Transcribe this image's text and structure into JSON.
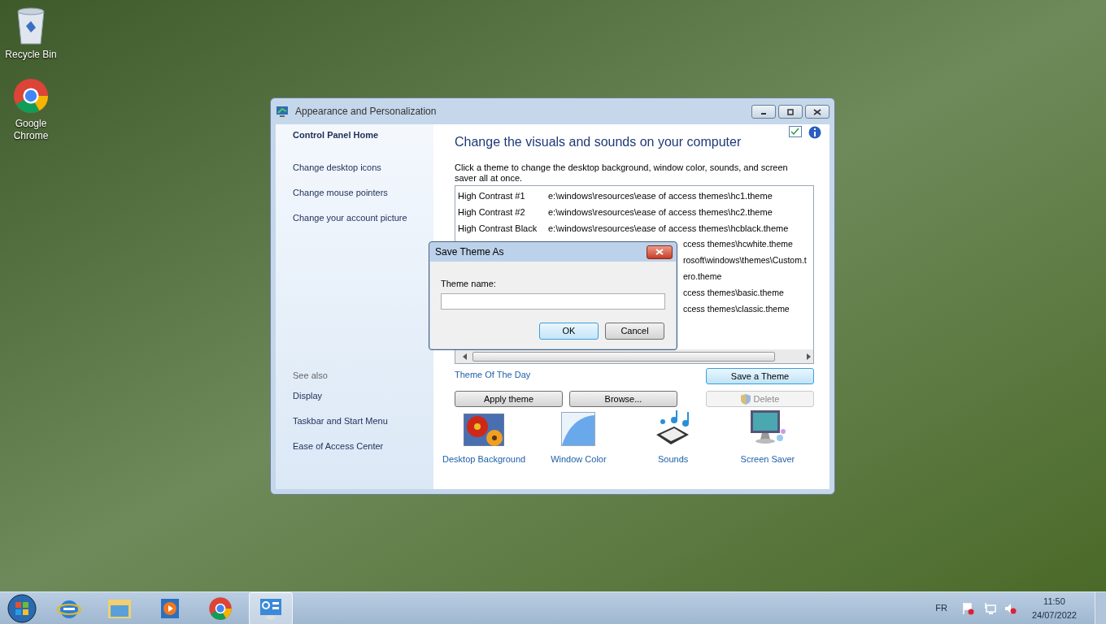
{
  "desktop_icons": [
    {
      "kind": "bin",
      "label": "Recycle Bin"
    },
    {
      "kind": "chrome",
      "label": "Google Chrome"
    }
  ],
  "window": {
    "title": "Appearance and Personalization",
    "sidebar": {
      "home": "Control Panel Home",
      "links": [
        "Change desktop icons",
        "Change mouse pointers",
        "Change your account picture"
      ],
      "see_also_title": "See also",
      "see_also": [
        "Display",
        "Taskbar and Start Menu",
        "Ease of Access Center"
      ]
    },
    "heading": "Change the visuals and sounds on your computer",
    "description": "Click a theme to change the desktop background, window color, sounds, and screen saver all at once.",
    "themes": [
      {
        "name": "High Contrast #1",
        "path": "e:\\windows\\resources\\ease of access themes\\hc1.theme"
      },
      {
        "name": "High Contrast #2",
        "path": "e:\\windows\\resources\\ease of access themes\\hc2.theme"
      },
      {
        "name": "High Contrast Black",
        "path": "e:\\windows\\resources\\ease of access themes\\hcblack.theme"
      },
      {
        "path": "ccess themes\\hcwhite.theme"
      },
      {
        "path": "rosoft\\windows\\themes\\Custom.t"
      },
      {
        "path": "ero.theme"
      },
      {
        "path": "ccess themes\\basic.theme"
      },
      {
        "path": "ccess themes\\classic.theme"
      }
    ],
    "theme_of_day": "Theme Of The Day",
    "buttons": [
      {
        "label": "Save a Theme",
        "kind": "default",
        "disabled": false
      },
      {
        "label": "Apply theme",
        "kind": "normal",
        "disabled": false
      },
      {
        "label": "Browse...",
        "kind": "normal",
        "disabled": false
      },
      {
        "label": "Delete",
        "kind": "shield",
        "disabled": true
      }
    ],
    "tiles": [
      {
        "kind": "background",
        "label": "Desktop Background"
      },
      {
        "kind": "color",
        "label": "Window Color"
      },
      {
        "kind": "sounds",
        "label": "Sounds"
      },
      {
        "kind": "saver",
        "label": "Screen Saver"
      }
    ]
  },
  "dialog": {
    "title": "Save Theme As",
    "field_label": "Theme name:",
    "buttons": [
      "OK",
      "Cancel"
    ]
  },
  "taskbar": {
    "apps": [
      {
        "kind": "ie",
        "active": false
      },
      {
        "kind": "explorer",
        "active": false
      },
      {
        "kind": "media",
        "active": false
      },
      {
        "kind": "chrome",
        "active": false
      },
      {
        "kind": "control",
        "active": true
      }
    ],
    "language": "FR",
    "time": "11:50",
    "date": "24/07/2022"
  }
}
